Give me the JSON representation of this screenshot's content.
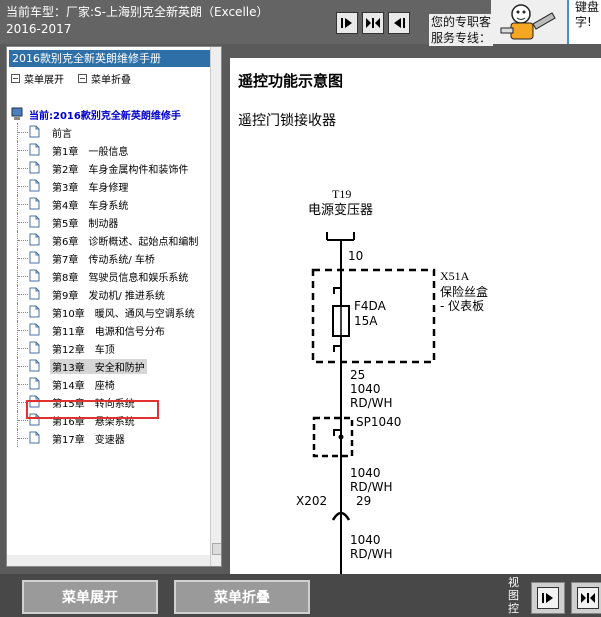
{
  "header": {
    "title_line1": "当前车型：厂家:S-上海别克全新英朗（Excelle）",
    "title_line2": "2016-2017",
    "service_line1": "您的专职客",
    "service_line2": "服务专线：",
    "ad_line1": "键盘",
    "ad_line2": "字!"
  },
  "sidebar": {
    "manual_title": "2016款别克全新英朗维修手册",
    "expand_label": "菜单展开",
    "collapse_label": "菜单折叠",
    "current_label": "当前:2016款别克全新英朗维修手",
    "items": [
      {
        "label": "前言"
      },
      {
        "label": "第1章　一般信息"
      },
      {
        "label": "第2章　车身金属构件和装饰件"
      },
      {
        "label": "第3章　车身修理"
      },
      {
        "label": "第4章　车身系统"
      },
      {
        "label": "第5章　制动器"
      },
      {
        "label": "第6章　诊断概述、起始点和编制"
      },
      {
        "label": "第7章　传动系统/ 车桥"
      },
      {
        "label": "第8章　驾驶员信息和娱乐系统"
      },
      {
        "label": "第9章　发动机/ 推进系统"
      },
      {
        "label": "第10章　暖风、通风与空调系统"
      },
      {
        "label": "第11章　电源和信号分布"
      },
      {
        "label": "第12章　车顶"
      },
      {
        "label": "第13章　安全和防护"
      },
      {
        "label": "第14章　座椅"
      },
      {
        "label": "第15章　转向系统"
      },
      {
        "label": "第16章　悬架系统"
      },
      {
        "label": "第17章　变速器"
      }
    ]
  },
  "content": {
    "heading": "遥控功能示意图",
    "subheading": "遥控门锁接收器",
    "diagram": {
      "t19": "T19",
      "transformer": "电源变压器",
      "wire_top": "10",
      "x51a": "X51A",
      "fusebox_line1": "保险丝盒",
      "fusebox_line2": "- 仪表板",
      "fuse_name": "F4DA",
      "fuse_rating": "15A",
      "w25": "25",
      "w1040a": "1040",
      "color_a": "RD/WH",
      "splice": "SP1040",
      "w1040b": "1040",
      "color_b": "RD/WH",
      "x202": "X202",
      "w29": "29",
      "w1040c": "1040",
      "color_c": "RD/WH"
    }
  },
  "footer": {
    "expand_button": "菜单展开",
    "collapse_button": "菜单折叠",
    "view_label": "视图控"
  },
  "colors": {
    "accent_blue": "#2f6fa8",
    "selection_red": "#e03030"
  }
}
